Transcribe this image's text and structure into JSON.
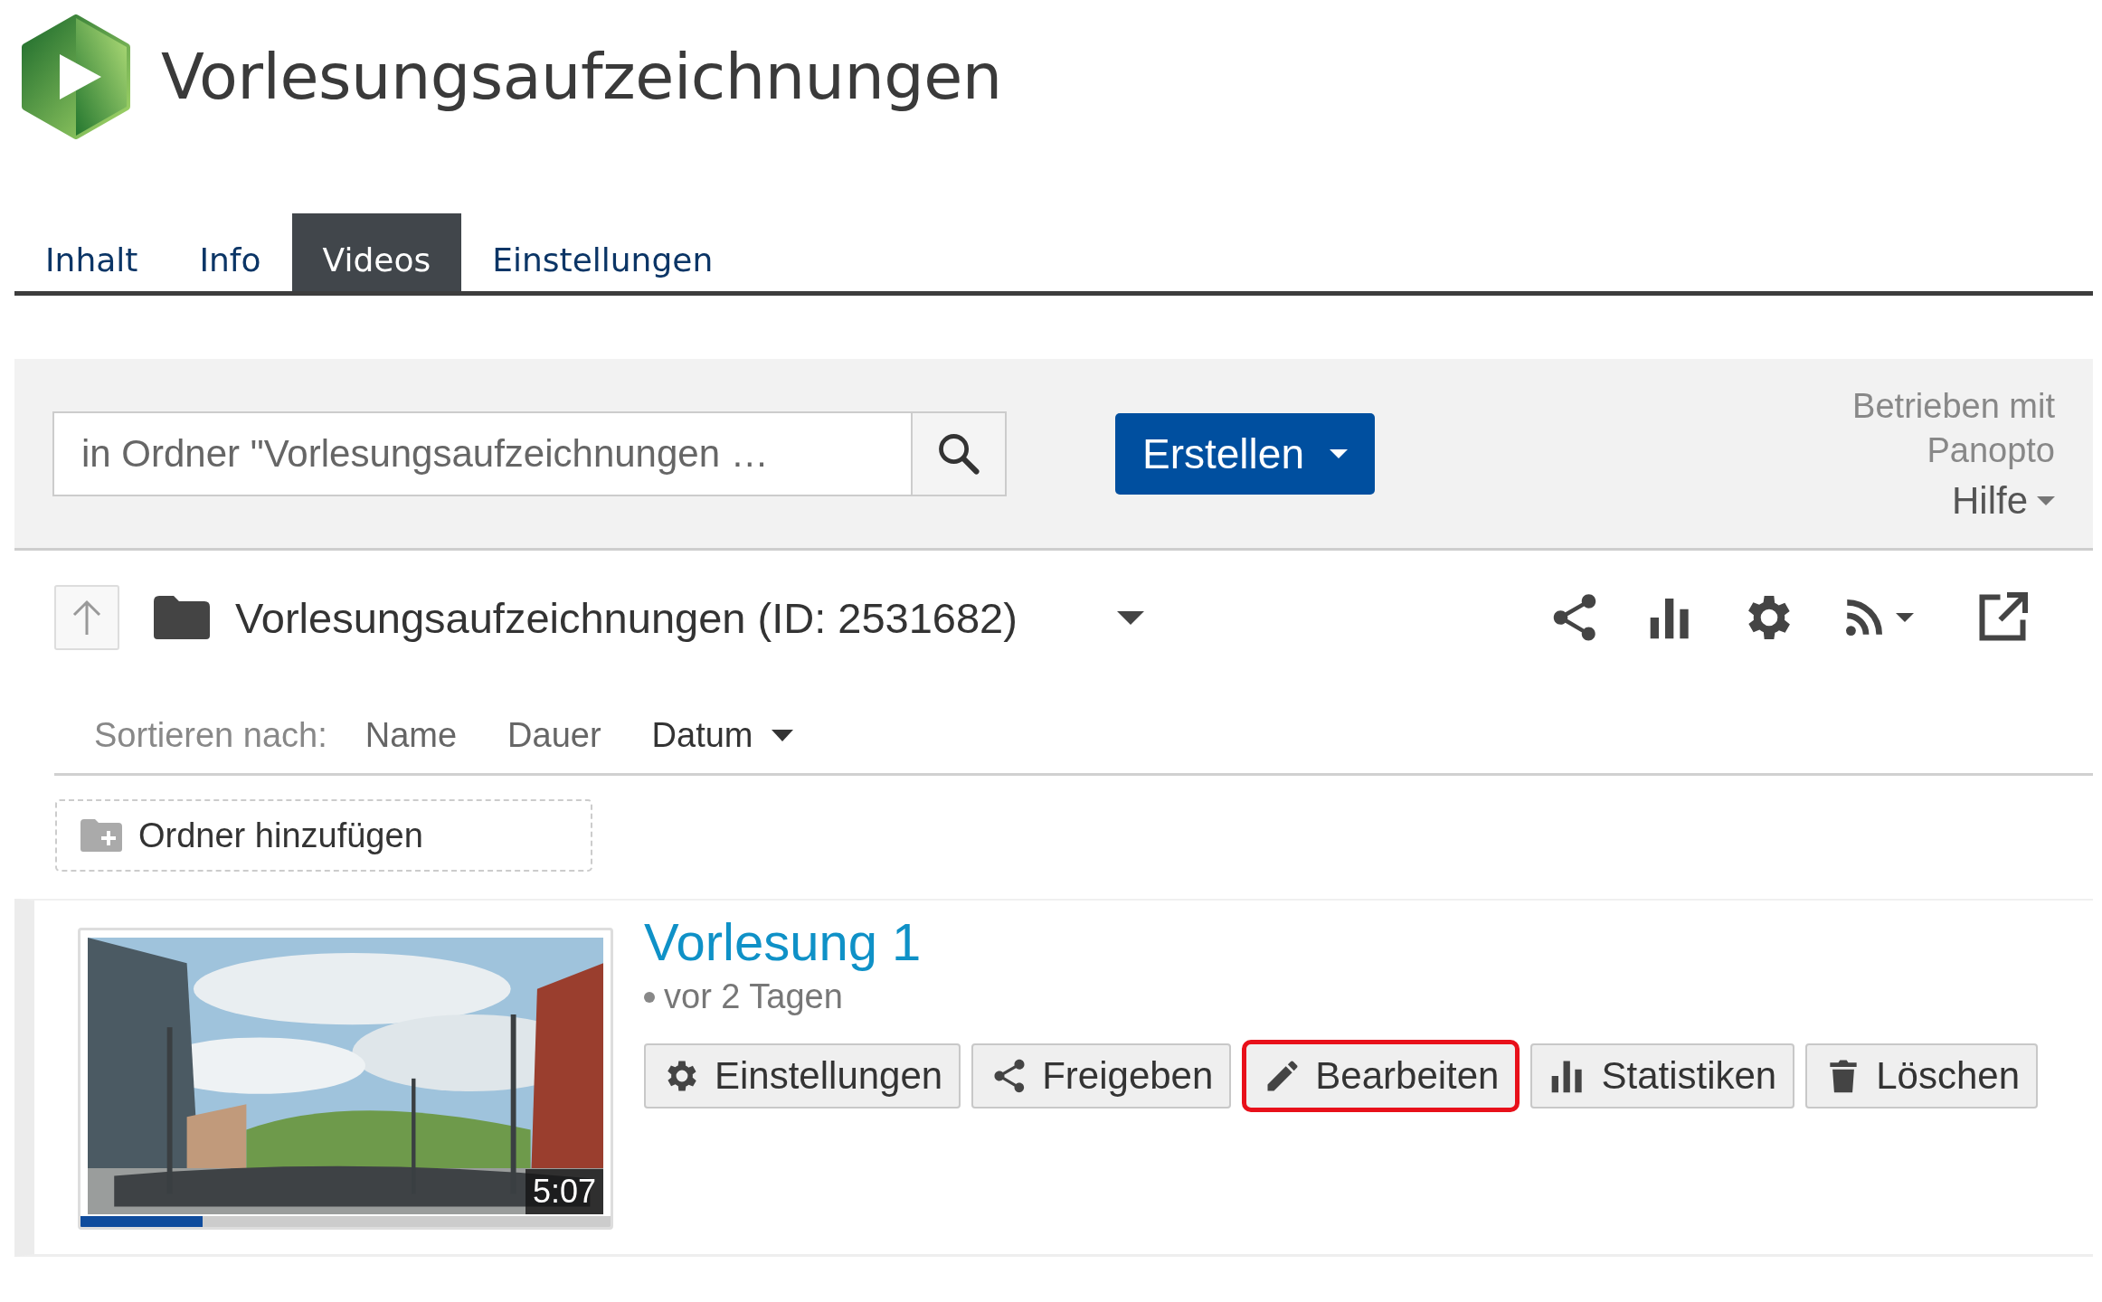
{
  "header": {
    "title": "Vorlesungsaufzeichnungen"
  },
  "tabs": [
    {
      "label": "Inhalt",
      "selected": false
    },
    {
      "label": "Info",
      "selected": false
    },
    {
      "label": "Videos",
      "selected": true
    },
    {
      "label": "Einstellungen",
      "selected": false
    }
  ],
  "toolbar": {
    "search": {
      "placeholder": "in Ordner \"Vorlesungsaufzeichnungen …"
    },
    "create_button": "Erstellen",
    "powered_by": [
      "Betrieben mit",
      "Panopto"
    ],
    "help_menu": "Hilfe"
  },
  "folder": {
    "name": "Vorlesungsaufzeichnungen (ID: 2531682)"
  },
  "sort": {
    "label": "Sortieren nach:",
    "options": [
      {
        "label": "Name",
        "selected": false
      },
      {
        "label": "Dauer",
        "selected": false
      },
      {
        "label": "Datum",
        "selected": true
      }
    ]
  },
  "add_folder": "Ordner hinzufügen",
  "sessions": [
    {
      "title": "Vorlesung 1",
      "age": "vor 2 Tagen",
      "duration": "5:07",
      "level": 0.23,
      "kind": "picture",
      "actions": [
        {
          "label": "Einstellungen",
          "highlighted": false
        },
        {
          "label": "Freigeben",
          "highlighted": false
        },
        {
          "label": "Bearbeiten",
          "highlighted": true
        },
        {
          "label": "Statistiken",
          "highlighted": false
        },
        {
          "label": "Löschen",
          "highlighted": false
        }
      ]
    }
  ]
}
